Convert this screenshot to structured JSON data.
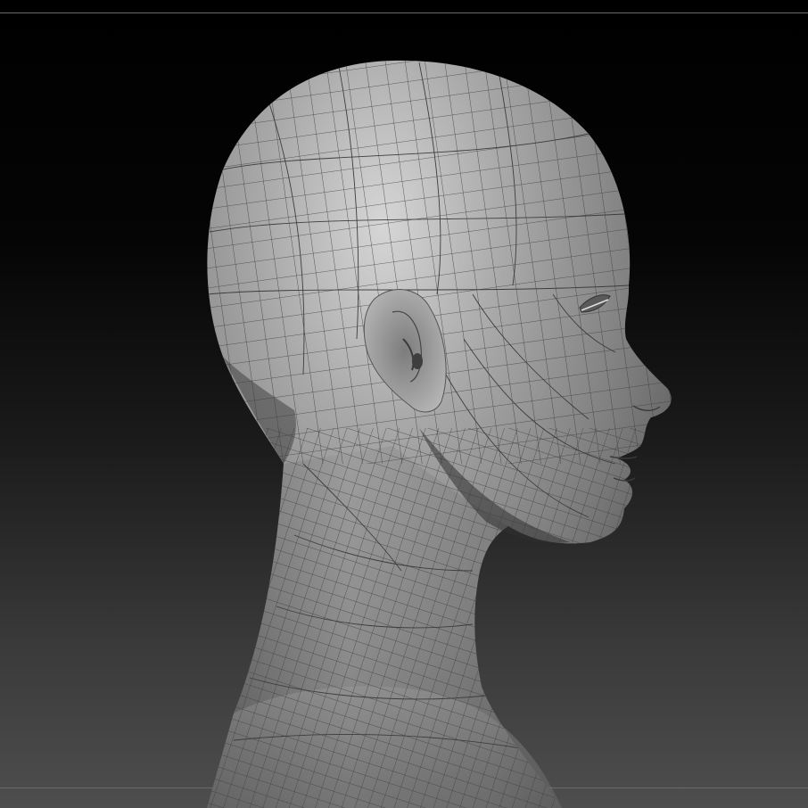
{
  "viewport": {
    "background_top": "#000000",
    "background_bottom": "#4e4e4e",
    "frame_line_color": "#6a6a6a"
  },
  "model": {
    "subject": "head-and-neck-sculpt",
    "view": "profile-right",
    "material_base": "#8e8e8e",
    "material_highlight": "#d4d4d4",
    "material_shadow": "#2a2a2a",
    "wireframe_color": "#3a3a3a",
    "wireframe_visible": true
  }
}
